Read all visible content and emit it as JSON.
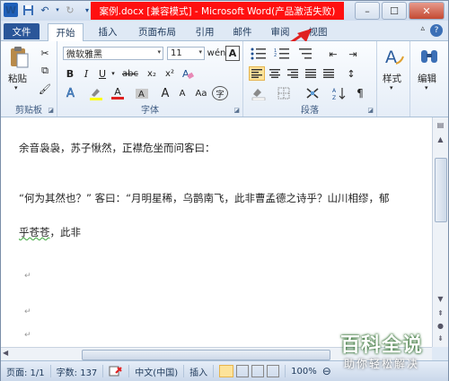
{
  "window": {
    "title": "案例.docx [兼容模式] - Microsoft Word(产品激活失败)",
    "controls": {
      "minimize": "–",
      "maximize": "☐",
      "close": "✕"
    }
  },
  "qat": {
    "logo": "W"
  },
  "tabs": [
    {
      "label": "文件"
    },
    {
      "label": "开始"
    },
    {
      "label": "插入"
    },
    {
      "label": "页面布局"
    },
    {
      "label": "引用"
    },
    {
      "label": "邮件"
    },
    {
      "label": "审阅"
    },
    {
      "label": "视图"
    }
  ],
  "ribbon": {
    "clipboard": {
      "label": "剪贴板",
      "paste_label": "粘贴"
    },
    "font": {
      "label": "字体",
      "font_name": "微软雅黑",
      "font_size": "11",
      "bold": "B",
      "italic": "I",
      "underline": "U",
      "strike": "abc",
      "subscript": "x₂",
      "superscript": "x²",
      "font_color": "A",
      "grow": "A",
      "shrink": "A",
      "char_border": "A",
      "wen": "wén",
      "phonetic": "字"
    },
    "paragraph": {
      "label": "段落"
    },
    "styles": {
      "label": "样式"
    },
    "editing": {
      "label": "编辑"
    }
  },
  "document": {
    "paragraphs": [
      "余音袅袅，苏子愀然，正襟危坐而问客曰：",
      "“何为其然也？” 客曰：“月明星稀，乌鹊南飞，此非曹孟德之诗乎？山川相缪，郁",
      "乎苍苍，此非"
    ],
    "wavy_word": "乎苍苍",
    "wavy_rest": "，此非",
    "para_mark": "↵"
  },
  "status": {
    "page": "页面: 1/1",
    "words": "字数: 137",
    "language": "中文(中国)",
    "mode": "插入",
    "zoom": "100%"
  },
  "watermark": {
    "big": "百科全说",
    "small": "助你轻松解决"
  },
  "colors": {
    "title_highlight": "#ff1010",
    "file_tab": "#2a5699",
    "arrow": "#e02020"
  }
}
